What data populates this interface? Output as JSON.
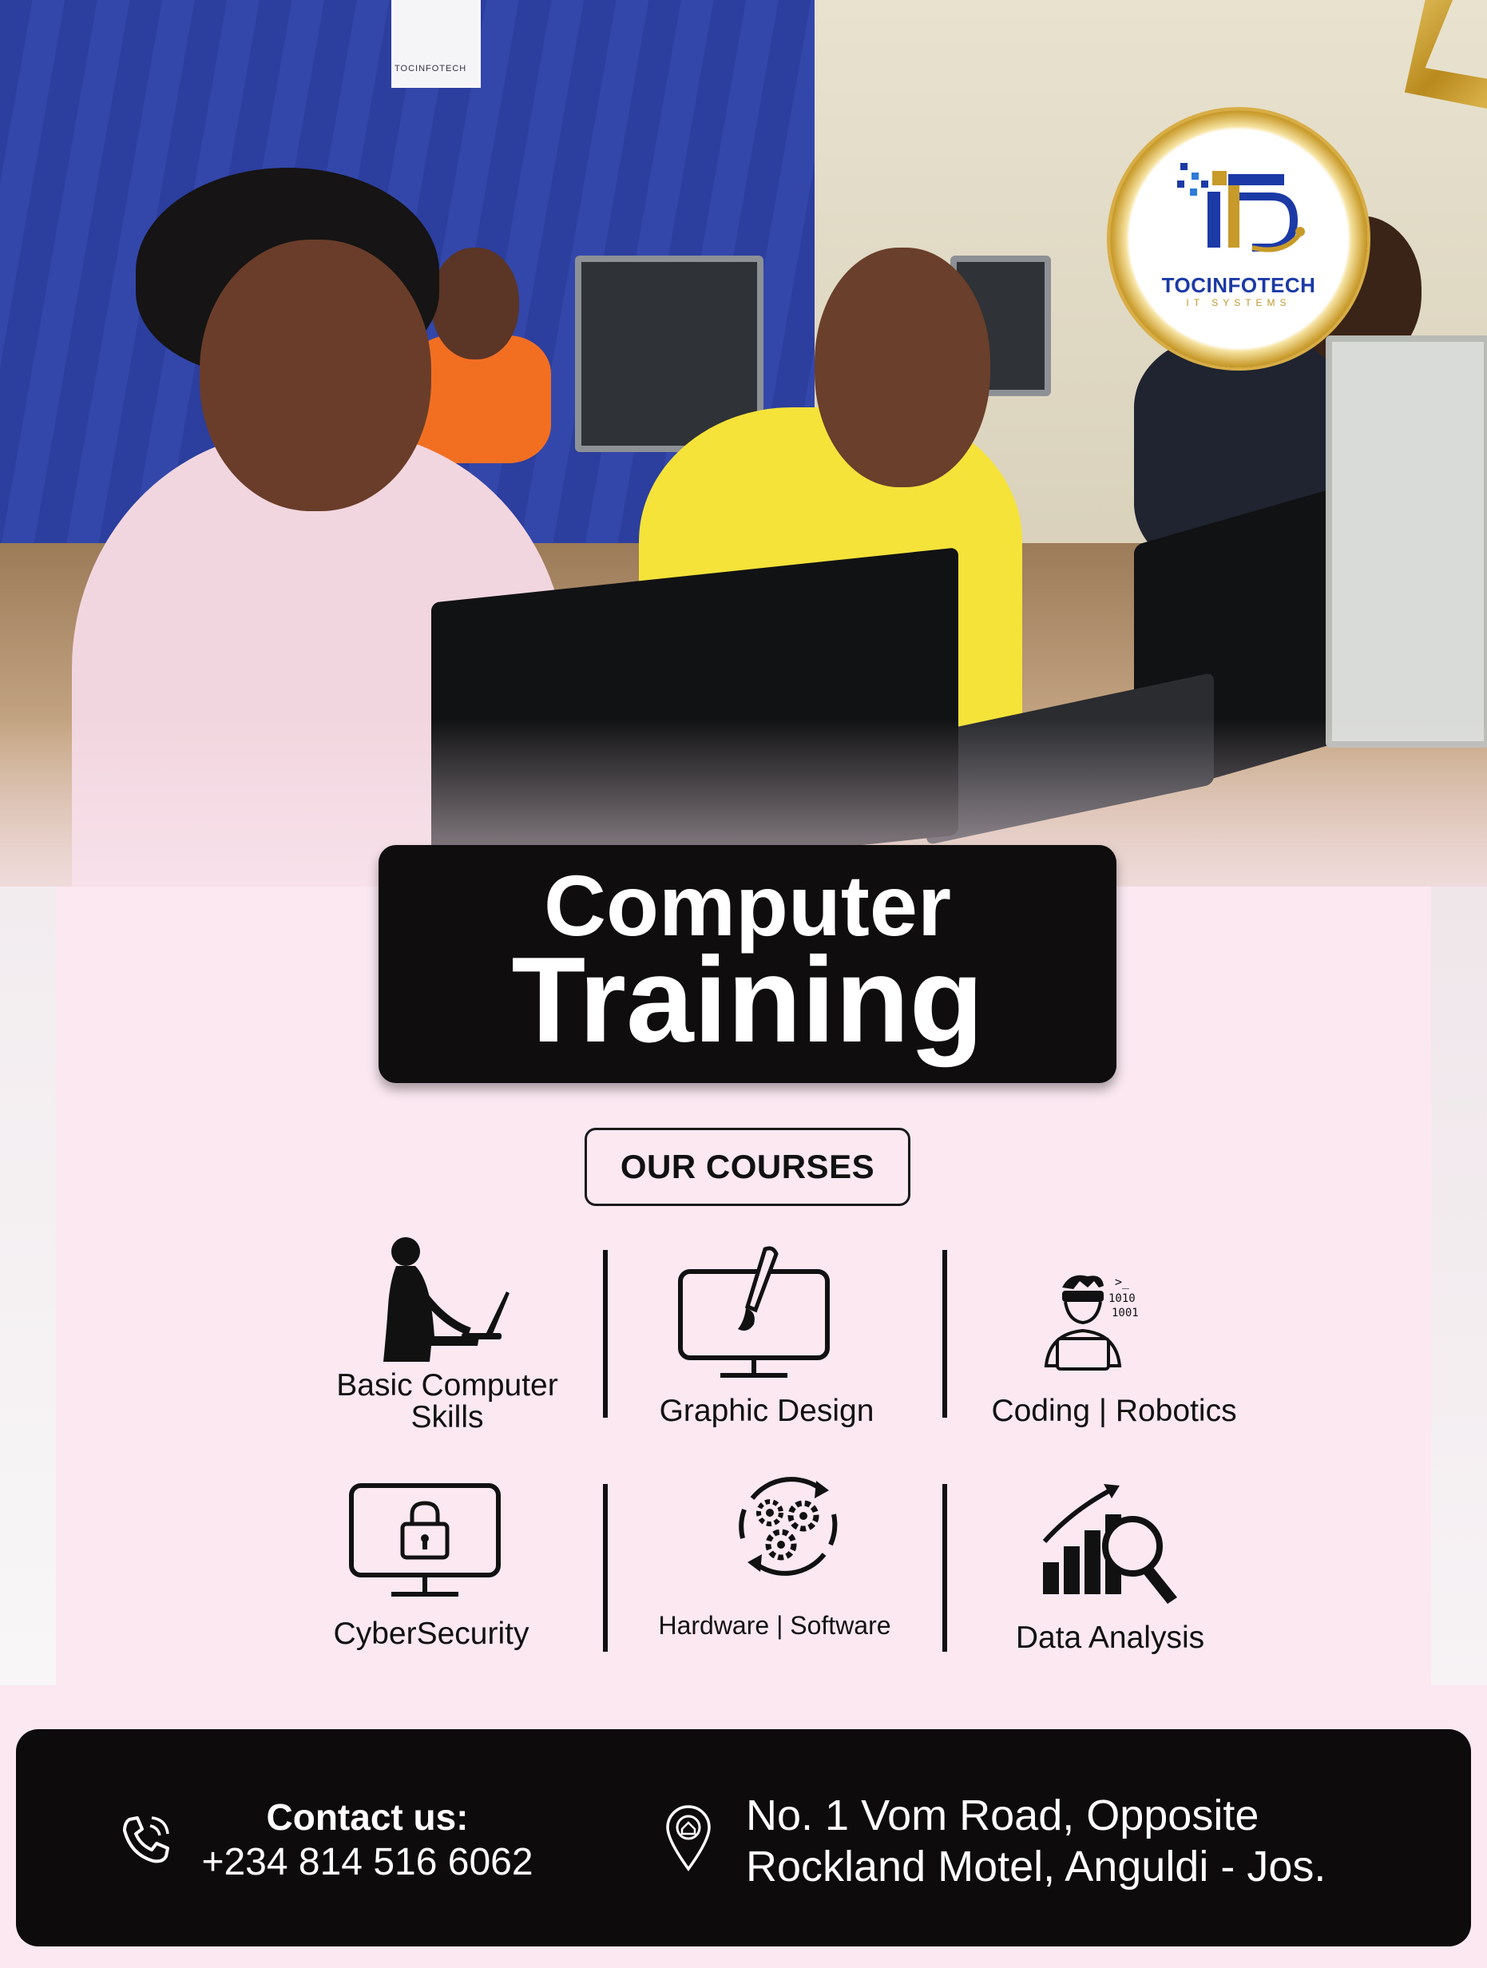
{
  "brand": {
    "name": "TOCINFOTECH",
    "tagline": "IT SYSTEMS",
    "banner_text": "TOCINFOTECH",
    "colors": {
      "blue": "#1c3aa6",
      "gold": "#c89a2a",
      "pink": "#fbe8f1",
      "black": "#0f0d0e"
    }
  },
  "title": {
    "line1": "Computer",
    "line2": "Training"
  },
  "courses_heading": "OUR COURSES",
  "courses": [
    {
      "label_lines": [
        "Basic Computer",
        "Skills"
      ],
      "icon": "person-at-computer-icon"
    },
    {
      "label_lines": [
        "Graphic Design"
      ],
      "icon": "monitor-brush-icon"
    },
    {
      "label_lines": [
        "Coding | Robotics"
      ],
      "icon": "coder-laptop-icon"
    },
    {
      "label_lines": [
        "CyberSecurity"
      ],
      "icon": "monitor-lock-icon"
    },
    {
      "label_lines": [
        "Hardware | Software"
      ],
      "icon": "gears-cycle-icon"
    },
    {
      "label_lines": [
        "Data Analysis"
      ],
      "icon": "chart-magnifier-icon"
    }
  ],
  "coder_icon_text": {
    "prompt": ">_",
    "bits1": "1010",
    "bits2": "1001"
  },
  "footer": {
    "contact_title": "Contact us:",
    "phone": "+234 814 516 6062",
    "address_line1": "No. 1 Vom Road, Opposite",
    "address_line2": "Rockland Motel, Anguldi - Jos.",
    "phone_icon": "phone-icon",
    "location_icon": "location-pin-icon"
  }
}
